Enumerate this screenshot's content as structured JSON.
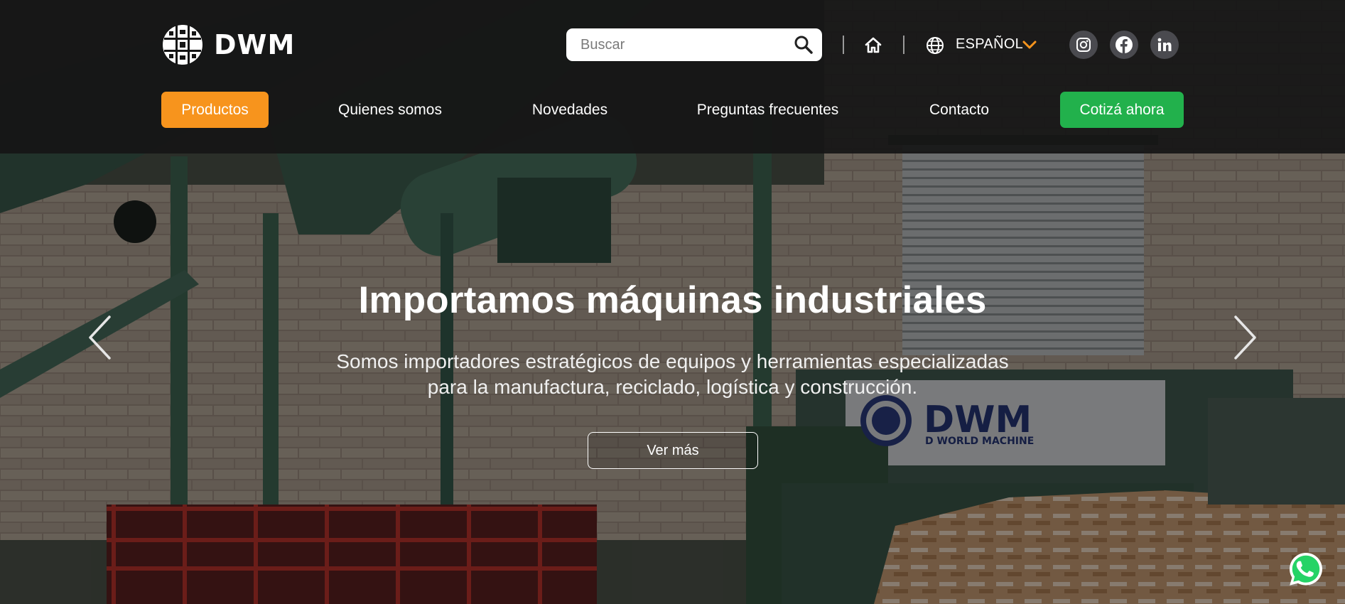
{
  "brand": {
    "name": "DWM"
  },
  "search": {
    "placeholder": "Buscar"
  },
  "language": {
    "label": "ESPAÑOL"
  },
  "social": [
    "instagram-icon",
    "facebook-icon",
    "linkedin-icon"
  ],
  "nav": {
    "items": [
      {
        "label": "Productos",
        "active": true
      },
      {
        "label": "Quienes somos"
      },
      {
        "label": "Novedades"
      },
      {
        "label": "Preguntas frecuentes"
      },
      {
        "label": "Contacto"
      }
    ],
    "cta": "Cotizá ahora"
  },
  "hero": {
    "title": "Importamos máquinas industriales",
    "subtitle_line1": "Somos importadores estratégicos de equipos y herramientas especializadas",
    "subtitle_line2": "para la manufactura, reciclado, logística y construcción.",
    "button": "Ver más",
    "machine_label": "DWM",
    "machine_sublabel": "D WORLD MACHINE"
  },
  "colors": {
    "accent_orange": "#f7941d",
    "cta_green": "#22b14c",
    "header_bg": "#161616",
    "whatsapp_green": "#25d366"
  }
}
